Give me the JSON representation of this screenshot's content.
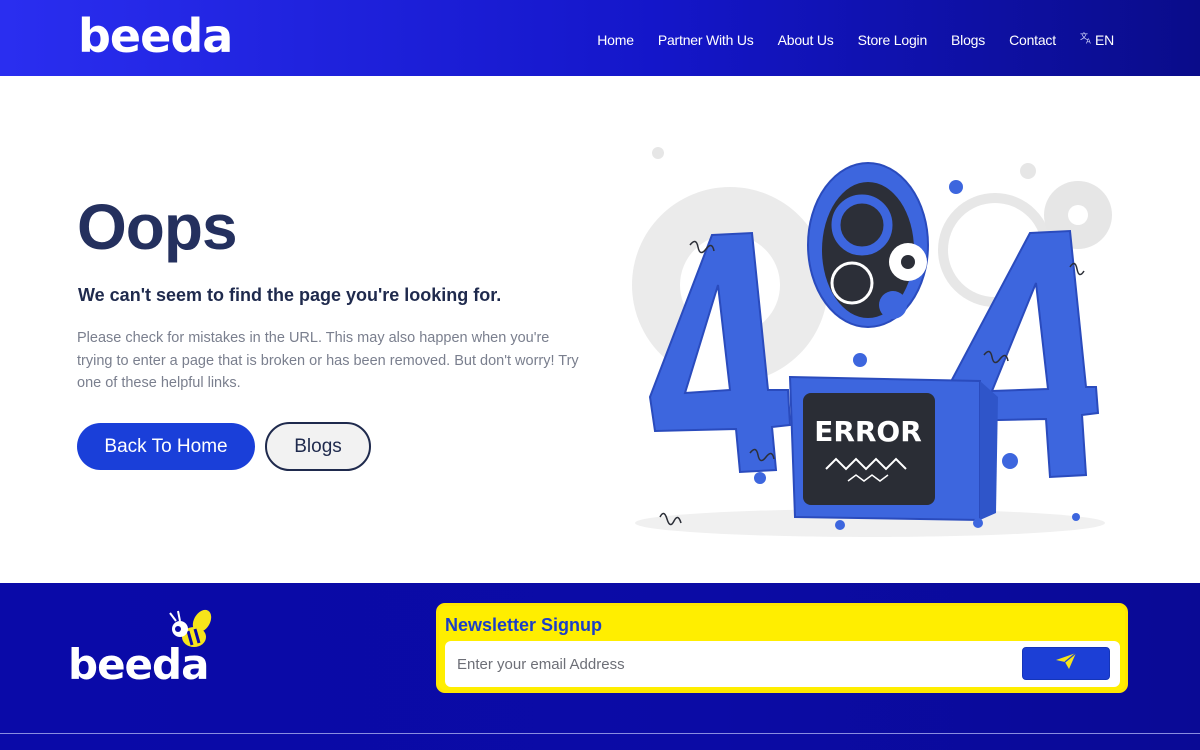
{
  "header": {
    "logo_text": "beeda",
    "nav": [
      {
        "label": "Home"
      },
      {
        "label": "Partner With Us"
      },
      {
        "label": "About Us"
      },
      {
        "label": "Store Login"
      },
      {
        "label": "Blogs"
      },
      {
        "label": "Contact"
      }
    ],
    "language": "EN",
    "language_icon": "translate-icon"
  },
  "main": {
    "title": "Oops",
    "subtitle": "We can't seem to find the page you're looking for.",
    "description": "Please check for mistakes in the URL. This may also happen when you're trying to enter a page that is broken or has been removed. But don't worry! Try one of these helpful links.",
    "primary_button": "Back To Home",
    "secondary_button": "Blogs",
    "illustration": {
      "digits": [
        "4",
        "0",
        "4"
      ],
      "box_label": "ERROR"
    }
  },
  "footer": {
    "logo_text": "beeda",
    "newsletter": {
      "title": "Newsletter Signup",
      "placeholder": "Enter your email Address",
      "send_icon": "paper-plane-icon"
    }
  },
  "colors": {
    "brand_blue": "#1a3fd9",
    "header_gradient_start": "#2a2ef0",
    "header_gradient_end": "#0a0c8a",
    "footer_blue": "#0a0aa8",
    "newsletter_yellow": "#ffee00",
    "heading_navy": "#24305e",
    "illustration_blue": "#3d66de"
  }
}
